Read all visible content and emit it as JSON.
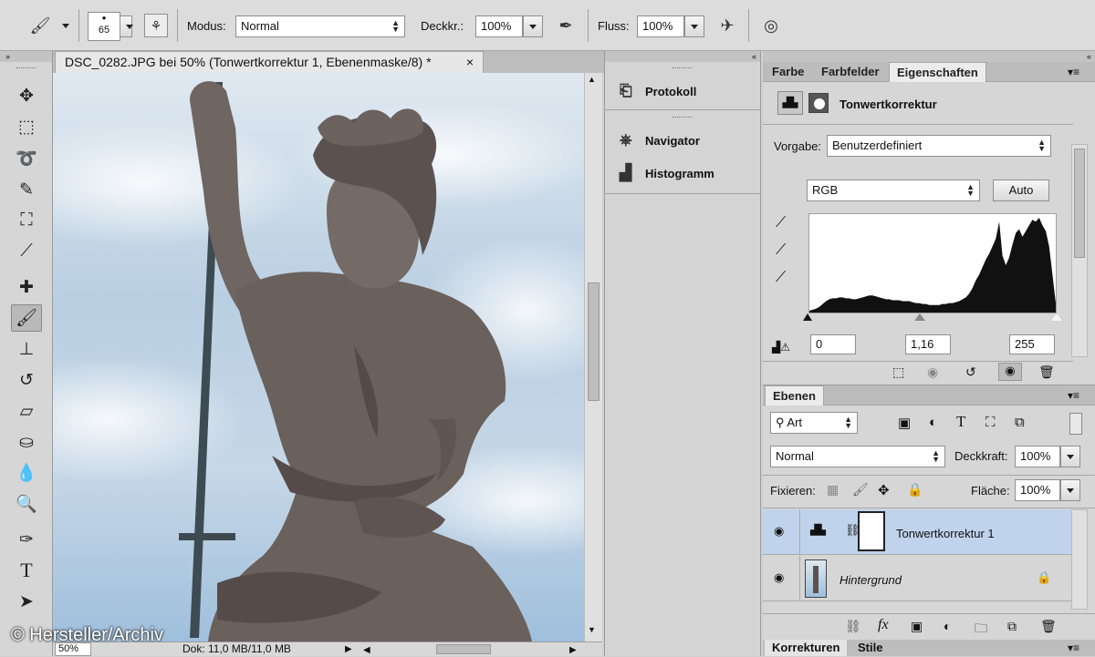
{
  "options_bar": {
    "brush_size": "65",
    "mode_label": "Modus:",
    "mode_value": "Normal",
    "opacity_label": "Deckkr.:",
    "opacity_value": "100%",
    "flow_label": "Fluss:",
    "flow_value": "100%"
  },
  "document": {
    "tab_title": "DSC_0282.JPG bei 50% (Tonwertkorrektur 1, Ebenenmaske/8) *",
    "close_glyph": "×",
    "zoom": "50%",
    "doc_info": "Dok: 11,0 MB/11,0 MB"
  },
  "middle_dock": {
    "protokoll": "Protokoll",
    "navigator": "Navigator",
    "histogramm": "Histogramm"
  },
  "properties": {
    "tabs": [
      "Farbe",
      "Farbfelder",
      "Eigenschaften"
    ],
    "panel_title": "Tonwertkorrektur",
    "preset_label": "Vorgabe:",
    "preset_value": "Benutzerdefiniert",
    "channel_value": "RGB",
    "auto_label": "Auto",
    "input_black": "0",
    "input_gamma": "1,16",
    "input_white": "255"
  },
  "layers_panel": {
    "tab": "Ebenen",
    "filter_kind": "Art",
    "blend_mode": "Normal",
    "opacity_label": "Deckkraft:",
    "opacity_value": "100%",
    "lock_label": "Fixieren:",
    "fill_label": "Fläche:",
    "fill_value": "100%",
    "layers": [
      {
        "name": "Tonwertkorrektur 1"
      },
      {
        "name": "Hintergrund"
      }
    ]
  },
  "bottom_tabs": [
    "Korrekturen",
    "Stile"
  ],
  "credit": "© Hersteller/Archiv",
  "histogram": [
    2,
    3,
    4,
    6,
    9,
    12,
    14,
    15,
    15,
    16,
    16,
    15,
    15,
    14,
    14,
    15,
    16,
    17,
    18,
    18,
    17,
    16,
    15,
    14,
    14,
    13,
    13,
    13,
    12,
    12,
    12,
    11,
    10,
    10,
    9,
    9,
    8,
    8,
    8,
    8,
    9,
    9,
    10,
    10,
    11,
    12,
    14,
    16,
    20,
    26,
    34,
    40,
    48,
    56,
    62,
    70,
    78,
    96,
    60,
    50,
    58,
    72,
    84,
    88,
    80,
    86,
    92,
    98,
    96,
    100,
    92,
    86,
    70,
    40,
    10
  ]
}
